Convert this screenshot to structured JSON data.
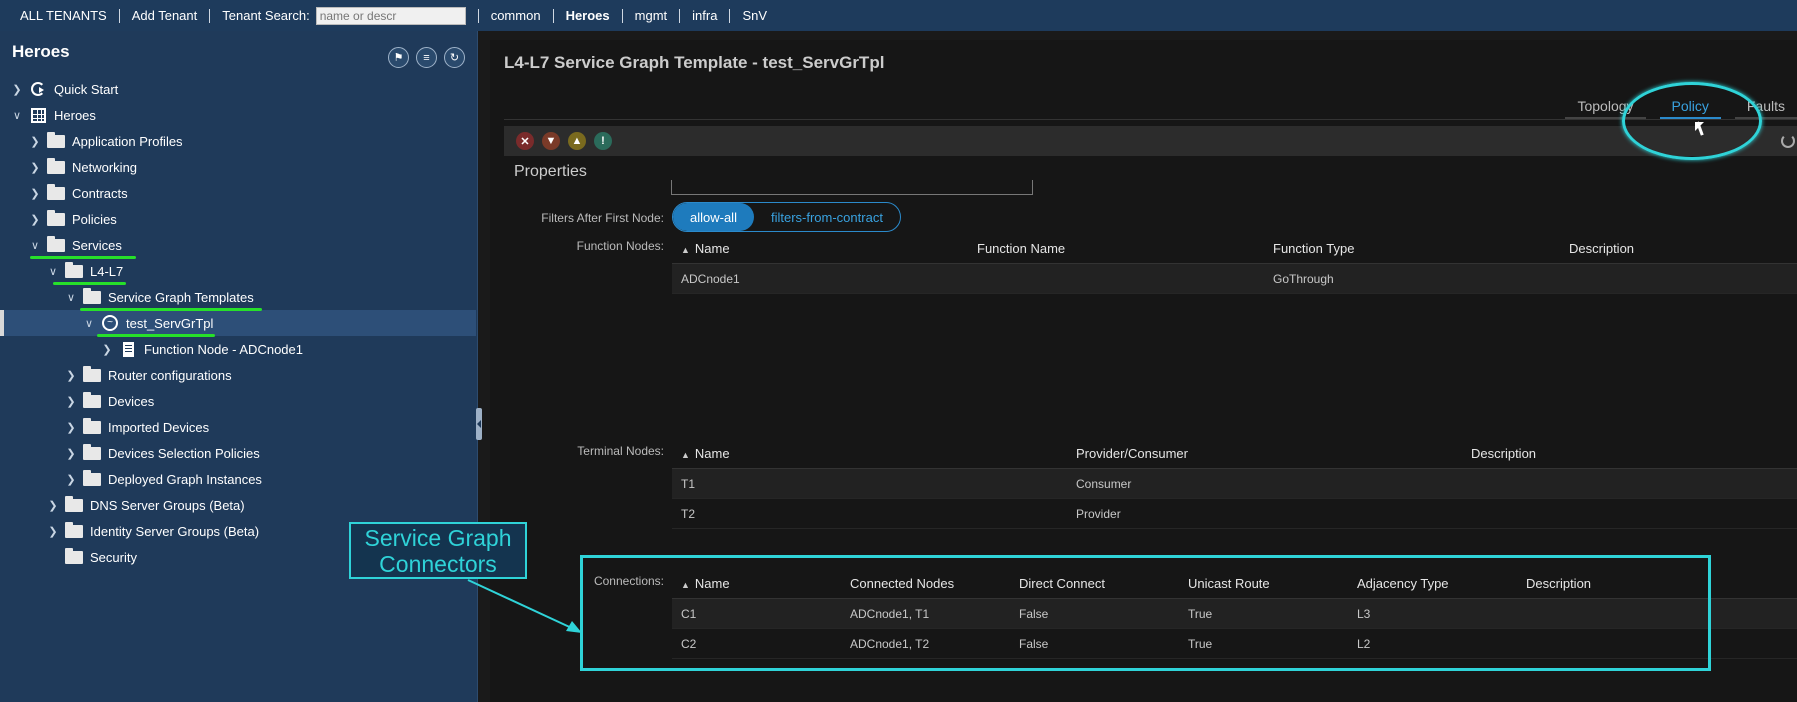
{
  "topbar": {
    "all_tenants": "ALL TENANTS",
    "add_tenant": "Add Tenant",
    "search_label": "Tenant Search:",
    "search_placeholder": "name or descr",
    "tenants": [
      "common",
      "Heroes",
      "mgmt",
      "infra",
      "SnV"
    ],
    "active_tenant": "Heroes"
  },
  "nav": {
    "title": "Heroes",
    "quick_start": "Quick Start",
    "tenant": "Heroes",
    "application_profiles": "Application Profiles",
    "networking": "Networking",
    "contracts": "Contracts",
    "policies": "Policies",
    "services": "Services",
    "l4l7": "L4-L7",
    "sgt": "Service Graph Templates",
    "graph": "test_ServGrTpl",
    "function_node": "Function Node - ADCnode1",
    "router_configurations": "Router configurations",
    "devices": "Devices",
    "imported_devices": "Imported Devices",
    "devices_selection_policies": "Devices Selection Policies",
    "deployed_graph_instances": "Deployed Graph Instances",
    "dns_server_groups": "DNS Server Groups (Beta)",
    "identity_server_groups": "Identity Server Groups (Beta)",
    "security": "Security"
  },
  "main": {
    "title": "L4-L7 Service Graph Template - test_ServGrTpl",
    "tabs": {
      "topology": "Topology",
      "policy": "Policy",
      "faults": "Faults"
    },
    "active_tab": "Policy",
    "properties": "Properties",
    "filters_label": "Filters After First Node:",
    "filter_options": {
      "allow_all": "allow-all",
      "from_contract": "filters-from-contract"
    },
    "filter_selected": "allow-all",
    "function_nodes": {
      "label": "Function Nodes:",
      "headers": {
        "name": "Name",
        "function_name": "Function Name",
        "function_type": "Function Type",
        "description": "Description"
      },
      "rows": [
        {
          "name": "ADCnode1",
          "function_name": "",
          "function_type": "GoThrough",
          "description": ""
        }
      ]
    },
    "terminal_nodes": {
      "label": "Terminal Nodes:",
      "headers": {
        "name": "Name",
        "provider_consumer": "Provider/Consumer",
        "description": "Description"
      },
      "rows": [
        {
          "name": "T1",
          "provider_consumer": "Consumer",
          "description": ""
        },
        {
          "name": "T2",
          "provider_consumer": "Provider",
          "description": ""
        }
      ]
    },
    "connections": {
      "label": "Connections:",
      "headers": {
        "name": "Name",
        "connected_nodes": "Connected Nodes",
        "direct_connect": "Direct Connect",
        "unicast_route": "Unicast Route",
        "adjacency_type": "Adjacency Type",
        "description": "Description"
      },
      "rows": [
        {
          "name": "C1",
          "connected_nodes": "ADCnode1, T1",
          "direct_connect": "False",
          "unicast_route": "True",
          "adjacency_type": "L3",
          "description": ""
        },
        {
          "name": "C2",
          "connected_nodes": "ADCnode1, T2",
          "direct_connect": "False",
          "unicast_route": "True",
          "adjacency_type": "L2",
          "description": ""
        }
      ]
    }
  },
  "annotation": {
    "line1": "Service Graph",
    "line2": "Connectors"
  },
  "colors": {
    "annotation": "#2fd3d8",
    "highlight_underline": "#27e02a",
    "accent": "#2b8acb",
    "nav_bg": "#1f3a5a"
  },
  "icons": {
    "toolbar": [
      "critical-fault-icon",
      "major-fault-icon",
      "minor-fault-icon",
      "warning-fault-icon"
    ],
    "nav_tools": [
      "flag-icon",
      "list-icon",
      "refresh-icon"
    ]
  }
}
